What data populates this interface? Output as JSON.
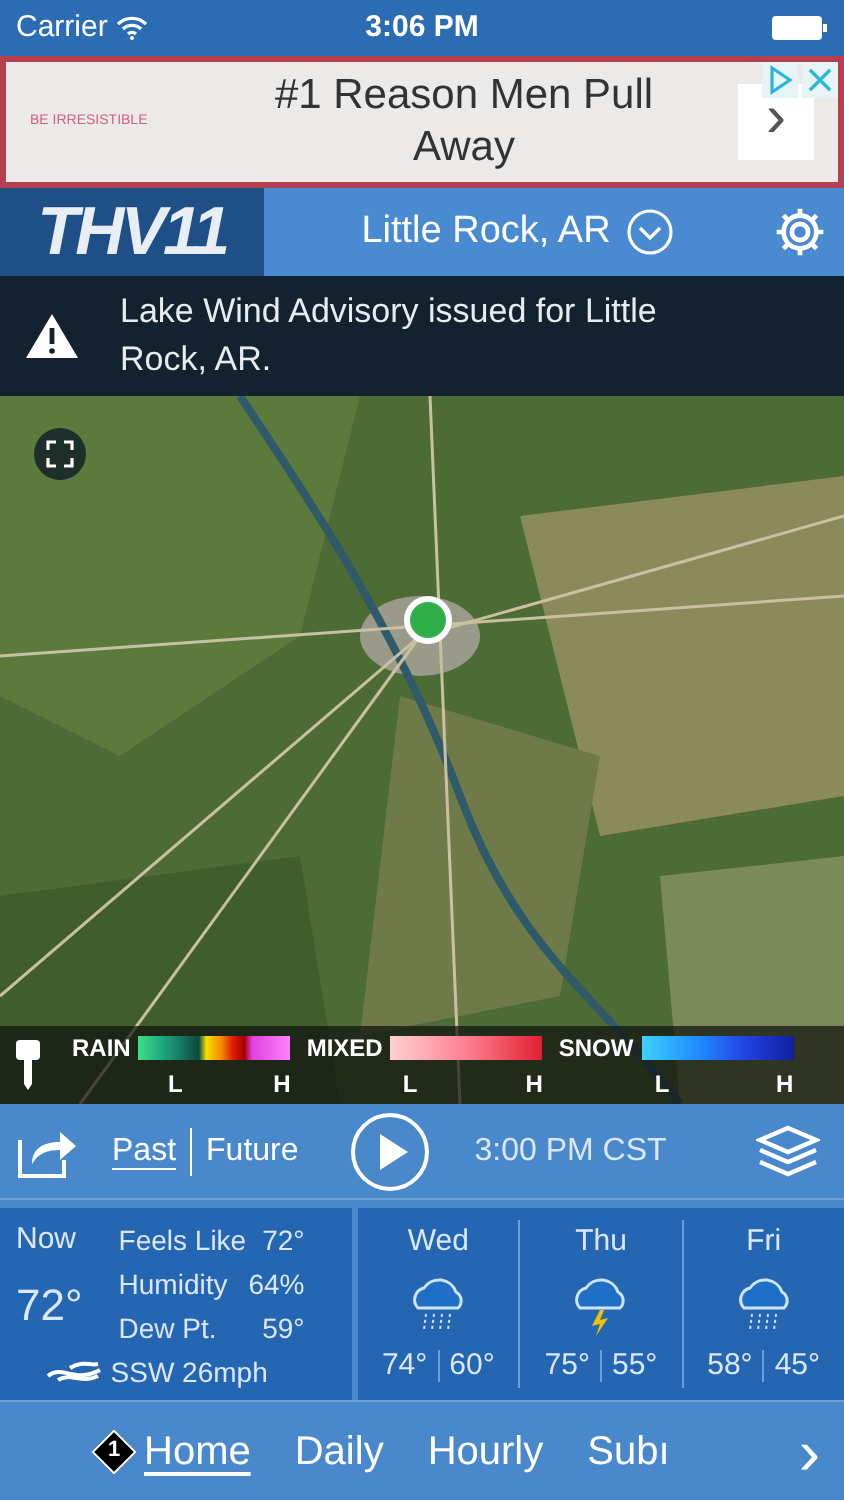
{
  "status_bar": {
    "carrier": "Carrier",
    "time": "3:06 PM"
  },
  "ad": {
    "brand": "BE IRRESISTIBLE",
    "headline": "#1 Reason Men Pull Away",
    "arrow": "›"
  },
  "header": {
    "logo": "THV11",
    "location": "Little Rock, AR"
  },
  "alert": {
    "text": "Lake Wind Advisory issued for Little Rock, AR."
  },
  "legend": [
    {
      "kind": "rain",
      "label": "RAIN",
      "low": "L",
      "high": "H"
    },
    {
      "kind": "mixed",
      "label": "MIXED",
      "low": "L",
      "high": "H"
    },
    {
      "kind": "snow",
      "label": "SNOW",
      "low": "L",
      "high": "H"
    }
  ],
  "playback": {
    "modes": [
      {
        "label": "Past",
        "selected": true
      },
      {
        "label": "Future",
        "selected": false
      }
    ],
    "time": "3:00 PM CST"
  },
  "current": {
    "label": "Now",
    "temp": "72°",
    "details": [
      {
        "label": "Feels Like",
        "value": "72°"
      },
      {
        "label": "Humidity",
        "value": "64%"
      },
      {
        "label": "Dew Pt.",
        "value": "59°"
      }
    ],
    "wind": "SSW 26mph"
  },
  "forecast": [
    {
      "day": "Wed",
      "kind": "rain",
      "high": "74°",
      "low": "60°"
    },
    {
      "day": "Thu",
      "kind": "storm",
      "high": "75°",
      "low": "55°"
    },
    {
      "day": "Fri",
      "kind": "rain",
      "high": "58°",
      "low": "45°"
    }
  ],
  "nav": {
    "badge": "1",
    "tabs": [
      {
        "label": "Home",
        "selected": true
      },
      {
        "label": "Daily",
        "selected": false
      },
      {
        "label": "Hourly",
        "selected": false
      },
      {
        "label": "Subı",
        "selected": false
      }
    ],
    "more": "›"
  }
}
